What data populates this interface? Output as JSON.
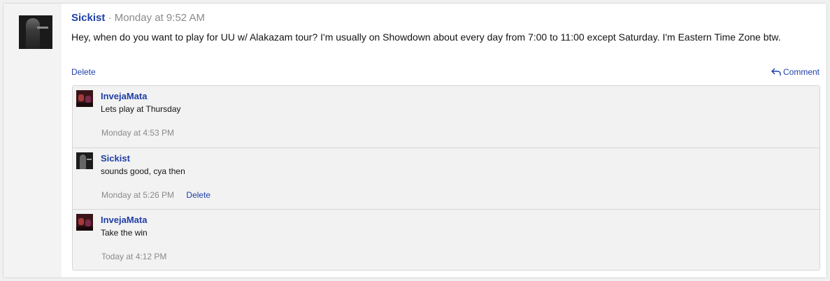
{
  "post": {
    "author": "Sickist",
    "separator": "·",
    "timestamp": "Monday at 9:52 AM",
    "message": "Hey, when do you want to play for UU w/ Alakazam tour? I'm usually on Showdown about every day from 7:00 to 11:00 except Saturday. I'm Eastern Time Zone btw.",
    "delete_label": "Delete",
    "comment_label": "Comment",
    "comment_icon": "reply-arrow-icon"
  },
  "replies": [
    {
      "author": "InvejaMata",
      "message": "Lets play at Thursday",
      "timestamp": "Monday at 4:53 PM",
      "avatar": "red-avatar"
    },
    {
      "author": "Sickist",
      "message": "sounds good, cya then",
      "timestamp": "Monday at 5:26 PM",
      "delete_label": "Delete",
      "avatar": "dark-avatar"
    },
    {
      "author": "InvejaMata",
      "message": "Take the win",
      "timestamp": "Today at 4:12 PM",
      "avatar": "red-avatar"
    }
  ],
  "colors": {
    "link": "#1f3ea6",
    "muted": "#8a8a8a",
    "reply_bg": "#f2f2f2"
  }
}
